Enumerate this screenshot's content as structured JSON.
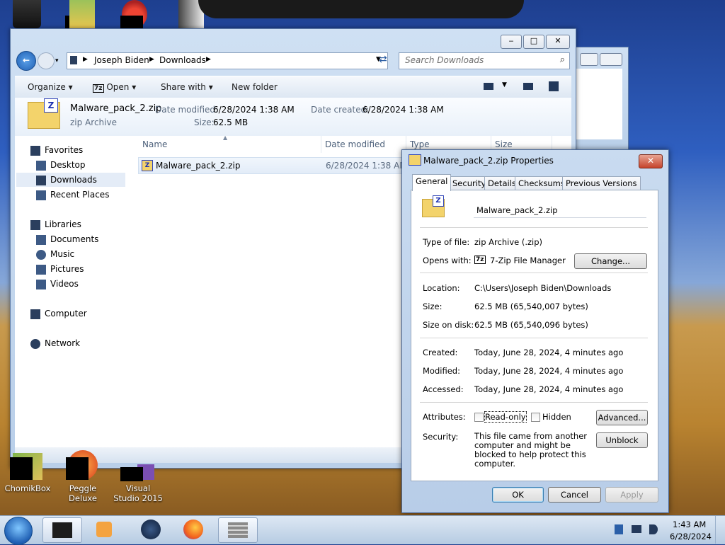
{
  "desktop": {
    "icons": [
      {
        "label": "ChomikBox"
      },
      {
        "label": "Peggle Deluxe"
      },
      {
        "label": "Visual Studio 2015"
      }
    ]
  },
  "explorer": {
    "breadcrumb": [
      "Joseph Biden",
      "Downloads"
    ],
    "search_placeholder": "Search Downloads",
    "toolbar": {
      "organize": "Organize",
      "open": "Open",
      "share_with": "Share with",
      "new_folder": "New folder"
    },
    "details": {
      "name": "Malware_pack_2.zip",
      "type": "zip Archive",
      "date_modified_label": "Date modified:",
      "date_modified": "6/28/2024 1:38 AM",
      "date_created_label": "Date created:",
      "date_created": "6/28/2024 1:38 AM",
      "size_label": "Size:",
      "size": "62.5 MB"
    },
    "nav": {
      "favorites": "Favorites",
      "desktop": "Desktop",
      "downloads": "Downloads",
      "recent_places": "Recent Places",
      "libraries": "Libraries",
      "documents": "Documents",
      "music": "Music",
      "pictures": "Pictures",
      "videos": "Videos",
      "computer": "Computer",
      "network": "Network"
    },
    "columns": [
      "Name",
      "Date modified",
      "Type",
      "Size"
    ],
    "files": [
      {
        "name": "Malware_pack_2.zip",
        "date_modified": "6/28/2024 1:38 AM"
      }
    ]
  },
  "properties": {
    "title": "Malware_pack_2.zip Properties",
    "tabs": [
      "General",
      "Security",
      "Details",
      "Checksums",
      "Previous Versions"
    ],
    "filename": "Malware_pack_2.zip",
    "type_label": "Type of file:",
    "type_value": "zip Archive (.zip)",
    "opens_label": "Opens with:",
    "opens_value": "7-Zip File Manager",
    "change_label": "Change...",
    "location_label": "Location:",
    "location_value": "C:\\Users\\Joseph Biden\\Downloads",
    "size_label": "Size:",
    "size_value": "62.5 MB (65,540,007 bytes)",
    "size_on_disk_label": "Size on disk:",
    "size_on_disk_value": "62.5 MB (65,540,096 bytes)",
    "created_label": "Created:",
    "created_value": "Today, June 28, 2024, 4 minutes ago",
    "modified_label": "Modified:",
    "modified_value": "Today, June 28, 2024, 4 minutes ago",
    "accessed_label": "Accessed:",
    "accessed_value": "Today, June 28, 2024, 4 minutes ago",
    "attributes_label": "Attributes:",
    "readonly_label": "Read-only",
    "hidden_label": "Hidden",
    "advanced_label": "Advanced...",
    "security_label": "Security:",
    "security_text": "This file came from another computer and might be blocked to help protect this computer.",
    "unblock_label": "Unblock",
    "ok_label": "OK",
    "cancel_label": "Cancel",
    "apply_label": "Apply"
  },
  "taskbar": {
    "time": "1:43 AM",
    "date": "6/28/2024"
  },
  "colors": {
    "accent": "#3c7fb1",
    "close": "#c5442c",
    "zip_folder": "#f3d36b"
  }
}
